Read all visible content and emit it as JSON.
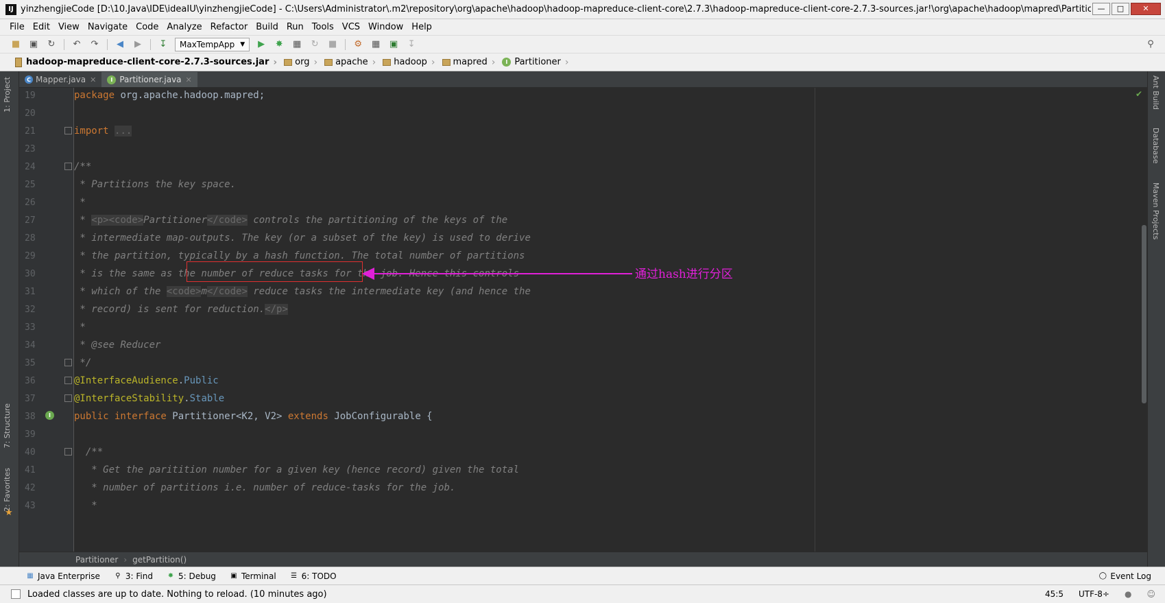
{
  "window": {
    "title": "yinzhengjieCode [D:\\10.Java\\IDE\\ideaIU\\yinzhengjieCode] - C:\\Users\\Administrator\\.m2\\repository\\org\\apache\\hadoop\\hadoop-mapreduce-client-core\\2.7.3\\hadoop-mapreduce-client-core-2.7.3-sources.jar!\\org\\apache\\hadoop\\mapred\\Partitioner.java [Maven: org.apac",
    "app_icon": "IJ"
  },
  "menu": [
    "File",
    "Edit",
    "View",
    "Navigate",
    "Code",
    "Analyze",
    "Refactor",
    "Build",
    "Run",
    "Tools",
    "VCS",
    "Window",
    "Help"
  ],
  "toolbar": {
    "run_config": "MaxTempApp"
  },
  "breadcrumb": {
    "jar": "hadoop-mapreduce-client-core-2.7.3-sources.jar",
    "folders": [
      "org",
      "apache",
      "hadoop",
      "mapred"
    ],
    "file": "Partitioner"
  },
  "left_tools": {
    "project": "1: Project",
    "structure": "7: Structure",
    "favorites": "2: Favorites"
  },
  "right_tools": {
    "ant": "Ant Build",
    "database": "Database",
    "maven": "Maven Projects"
  },
  "tabs": [
    {
      "label": "Mapper.java",
      "active": false
    },
    {
      "label": "Partitioner.java",
      "active": true
    }
  ],
  "code_lines": [
    {
      "n": "19",
      "segments": [
        {
          "c": "kw",
          "t": "package"
        },
        {
          "c": "",
          "t": " org.apache.hadoop.mapred;"
        }
      ]
    },
    {
      "n": "20",
      "segments": []
    },
    {
      "n": "21",
      "segments": [
        {
          "c": "kw",
          "t": "import"
        },
        {
          "c": "",
          "t": " "
        },
        {
          "c": "tag",
          "t": "..."
        }
      ]
    },
    {
      "n": "23",
      "segments": []
    },
    {
      "n": "24",
      "segments": [
        {
          "c": "cmt",
          "t": "/**"
        }
      ]
    },
    {
      "n": "25",
      "segments": [
        {
          "c": "cmt",
          "t": " * Partitions the key space."
        }
      ]
    },
    {
      "n": "26",
      "segments": [
        {
          "c": "cmt",
          "t": " *"
        }
      ]
    },
    {
      "n": "27",
      "segments": [
        {
          "c": "cmt",
          "t": " * "
        },
        {
          "c": "tag",
          "t": "<p><code>"
        },
        {
          "c": "cmt",
          "t": "Partitioner"
        },
        {
          "c": "tag",
          "t": "</code>"
        },
        {
          "c": "cmt",
          "t": " controls the partitioning of the keys of the"
        }
      ]
    },
    {
      "n": "28",
      "segments": [
        {
          "c": "cmt",
          "t": " * intermediate map-outputs. The key (or a subset of the key) is used to derive"
        }
      ]
    },
    {
      "n": "29",
      "segments": [
        {
          "c": "cmt",
          "t": " * the partition, typically by a hash function. The total number of partitions"
        }
      ]
    },
    {
      "n": "30",
      "segments": [
        {
          "c": "cmt",
          "t": " * is the same as the number of reduce tasks for the job. Hence this controls"
        }
      ]
    },
    {
      "n": "31",
      "segments": [
        {
          "c": "cmt",
          "t": " * which of the "
        },
        {
          "c": "tag",
          "t": "<code>"
        },
        {
          "c": "cmt",
          "t": "m"
        },
        {
          "c": "tag",
          "t": "</code>"
        },
        {
          "c": "cmt",
          "t": " reduce tasks the intermediate key (and hence the"
        }
      ]
    },
    {
      "n": "32",
      "segments": [
        {
          "c": "cmt",
          "t": " * record) is sent for reduction."
        },
        {
          "c": "tag",
          "t": "</p>"
        }
      ]
    },
    {
      "n": "33",
      "segments": [
        {
          "c": "cmt",
          "t": " *"
        }
      ]
    },
    {
      "n": "34",
      "segments": [
        {
          "c": "cmt",
          "t": " * "
        },
        {
          "c": "cmt",
          "t": "@see"
        },
        {
          "c": "cmt",
          "t": " Reducer"
        }
      ]
    },
    {
      "n": "35",
      "segments": [
        {
          "c": "cmt",
          "t": " */"
        }
      ]
    },
    {
      "n": "36",
      "segments": [
        {
          "c": "ann",
          "t": "@InterfaceAudience"
        },
        {
          "c": "",
          "t": "."
        },
        {
          "c": "ann-b",
          "t": "Public"
        }
      ]
    },
    {
      "n": "37",
      "segments": [
        {
          "c": "ann",
          "t": "@InterfaceStability"
        },
        {
          "c": "",
          "t": "."
        },
        {
          "c": "ann-b",
          "t": "Stable"
        }
      ]
    },
    {
      "n": "38",
      "segments": [
        {
          "c": "kw",
          "t": "public interface"
        },
        {
          "c": "",
          "t": " Partitioner<K2, V2> "
        },
        {
          "c": "kw",
          "t": "extends"
        },
        {
          "c": "",
          "t": " JobConfigurable {"
        }
      ]
    },
    {
      "n": "39",
      "segments": []
    },
    {
      "n": "40",
      "segments": [
        {
          "c": "cmt",
          "t": "  /**"
        }
      ]
    },
    {
      "n": "41",
      "segments": [
        {
          "c": "cmt",
          "t": "   * Get the paritition number for a given key (hence record) given the total"
        }
      ]
    },
    {
      "n": "42",
      "segments": [
        {
          "c": "cmt",
          "t": "   * number of partitions i.e. number of reduce-tasks for the job."
        }
      ]
    },
    {
      "n": "43",
      "segments": [
        {
          "c": "cmt",
          "t": "   *"
        }
      ]
    }
  ],
  "annotation": {
    "text": "通过hash进行分区",
    "color": "#e020d8"
  },
  "editor_crumbs": [
    "Partitioner",
    "getPartition()"
  ],
  "tool_windows": [
    {
      "label": "Java Enterprise",
      "icon": "java-enterprise-icon"
    },
    {
      "label": "3: Find",
      "icon": "search-icon"
    },
    {
      "label": "5: Debug",
      "icon": "bug-icon"
    },
    {
      "label": "Terminal",
      "icon": "terminal-icon"
    },
    {
      "label": "6: TODO",
      "icon": "todo-icon"
    }
  ],
  "event_log": "Event Log",
  "status": {
    "message": "Loaded classes are up to date. Nothing to reload. (10 minutes ago)",
    "position": "45:5",
    "encoding": "UTF-8÷"
  }
}
